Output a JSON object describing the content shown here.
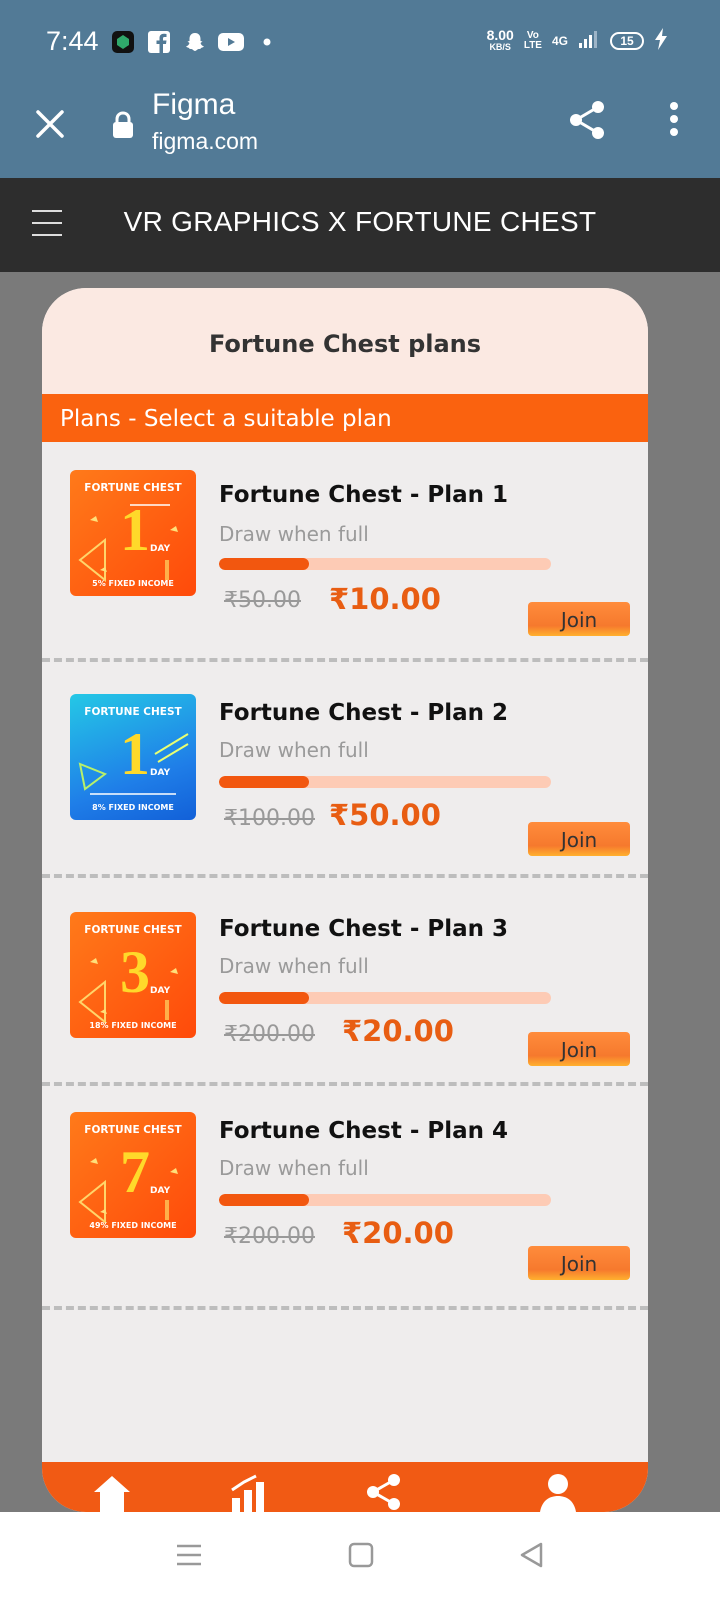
{
  "status_bar": {
    "time": "7:44",
    "net_speed_value": "8.00",
    "net_speed_unit": "KB/S",
    "network": "4G",
    "battery": "15",
    "icons": [
      "app-icon",
      "facebook-icon",
      "snapchat-icon",
      "youtube-icon",
      "dot-icon"
    ]
  },
  "browser": {
    "site_name": "Figma",
    "site_url": "figma.com"
  },
  "app": {
    "title": "VR GRAPHICS X FORTUNE CHEST"
  },
  "card": {
    "title": "Fortune Chest plans",
    "banner": "Plans - Select a suitable plan"
  },
  "plans": [
    {
      "name": "Fortune Chest - Plan 1",
      "subtitle": "Draw when full",
      "old_price": "₹50.00",
      "new_price": "₹10.00",
      "progress": 0.27,
      "join": "Join",
      "thumb_top": "FORTUNE CHEST",
      "thumb_num": "1",
      "thumb_day": "DAY",
      "thumb_bottom": "5% FIXED INCOME",
      "color": "orange"
    },
    {
      "name": "Fortune Chest - Plan 2",
      "subtitle": "Draw when full",
      "old_price": "₹100.00",
      "new_price": "₹50.00",
      "progress": 0.27,
      "join": "Join",
      "thumb_top": "FORTUNE CHEST",
      "thumb_num": "1",
      "thumb_day": "DAY",
      "thumb_bottom": "8% FIXED INCOME",
      "color": "blue"
    },
    {
      "name": "Fortune Chest - Plan 3",
      "subtitle": "Draw when full",
      "old_price": "₹200.00",
      "new_price": "₹20.00",
      "progress": 0.27,
      "join": "Join",
      "thumb_top": "FORTUNE CHEST",
      "thumb_num": "3",
      "thumb_day": "DAY",
      "thumb_bottom": "18% FIXED INCOME",
      "color": "orange"
    },
    {
      "name": "Fortune Chest - Plan 4",
      "subtitle": "Draw when full",
      "old_price": "₹200.00",
      "new_price": "₹20.00",
      "progress": 0.27,
      "join": "Join",
      "thumb_top": "FORTUNE CHEST",
      "thumb_num": "7",
      "thumb_day": "DAY",
      "thumb_bottom": "49% FIXED INCOME",
      "color": "orange"
    }
  ],
  "bottom_nav": [
    "home-icon",
    "stats-icon",
    "share-icon",
    "profile-icon"
  ],
  "colors": {
    "accent": "#fa620f",
    "price": "#e85d12",
    "header": "#2d2d2d",
    "browser": "#527a96"
  }
}
